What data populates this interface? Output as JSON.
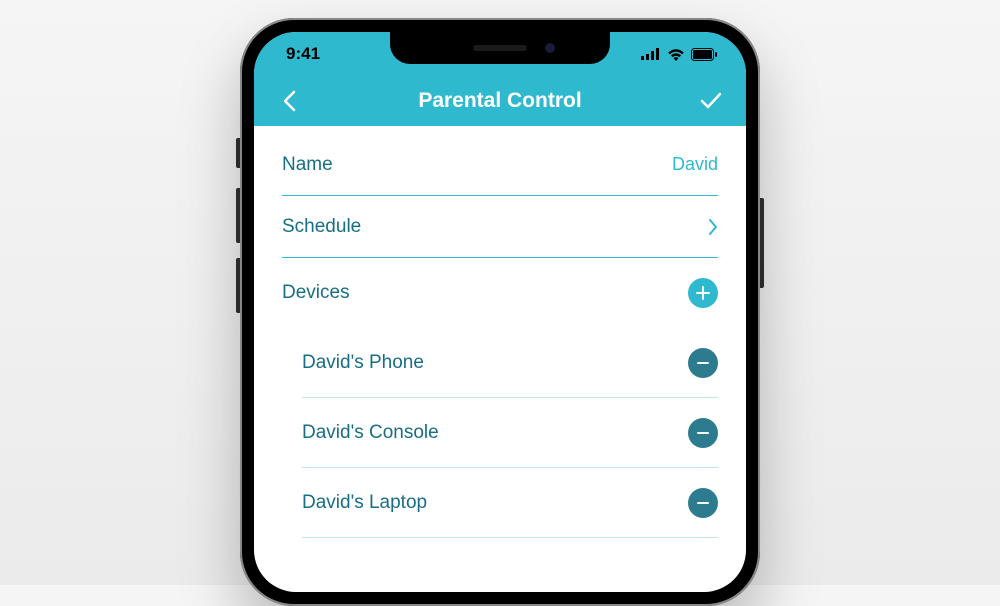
{
  "status_bar": {
    "time": "9:41"
  },
  "nav": {
    "title": "Parental Control"
  },
  "rows": {
    "name_label": "Name",
    "name_value": "David",
    "schedule_label": "Schedule",
    "devices_label": "Devices"
  },
  "devices": [
    {
      "label": "David's Phone"
    },
    {
      "label": "David's Console"
    },
    {
      "label": "David's Laptop"
    }
  ]
}
